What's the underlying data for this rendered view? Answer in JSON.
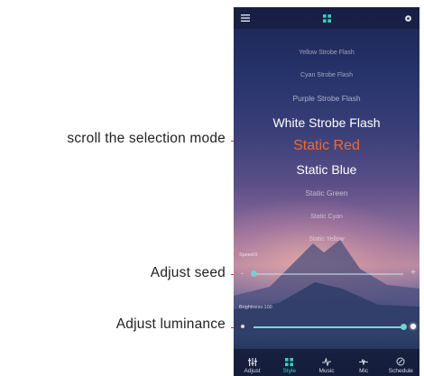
{
  "annotations": {
    "scroll": "scroll the selection mode",
    "speed": "Adjust  seed",
    "luminance": "Adjust  luminance"
  },
  "modes": {
    "items": [
      "Yellow Strobe Flash",
      "Cyan Strobe Flash",
      "Purple Strobe Flash",
      "White Strobe Flash",
      "Static Red",
      "Static Blue",
      "Static Green",
      "Static Cyan",
      "Static Yellow"
    ],
    "selected_index": 4
  },
  "speed": {
    "label": "Speed:0",
    "level": 0.0
  },
  "brightness": {
    "label": "Brightness:100",
    "level": 1.0
  },
  "tabs": [
    {
      "label": "Adjust",
      "icon": "sliders-icon"
    },
    {
      "label": "Style",
      "icon": "grid-icon"
    },
    {
      "label": "Music",
      "icon": "music-note-icon"
    },
    {
      "label": "Mic",
      "icon": "microphone-icon"
    },
    {
      "label": "Schedule",
      "icon": "clock-icon"
    }
  ],
  "active_tab": "Style",
  "colors": {
    "accent": "#3ecfbf",
    "selected_mode": "#f26a2a",
    "annotation_line": "#dd3333"
  }
}
